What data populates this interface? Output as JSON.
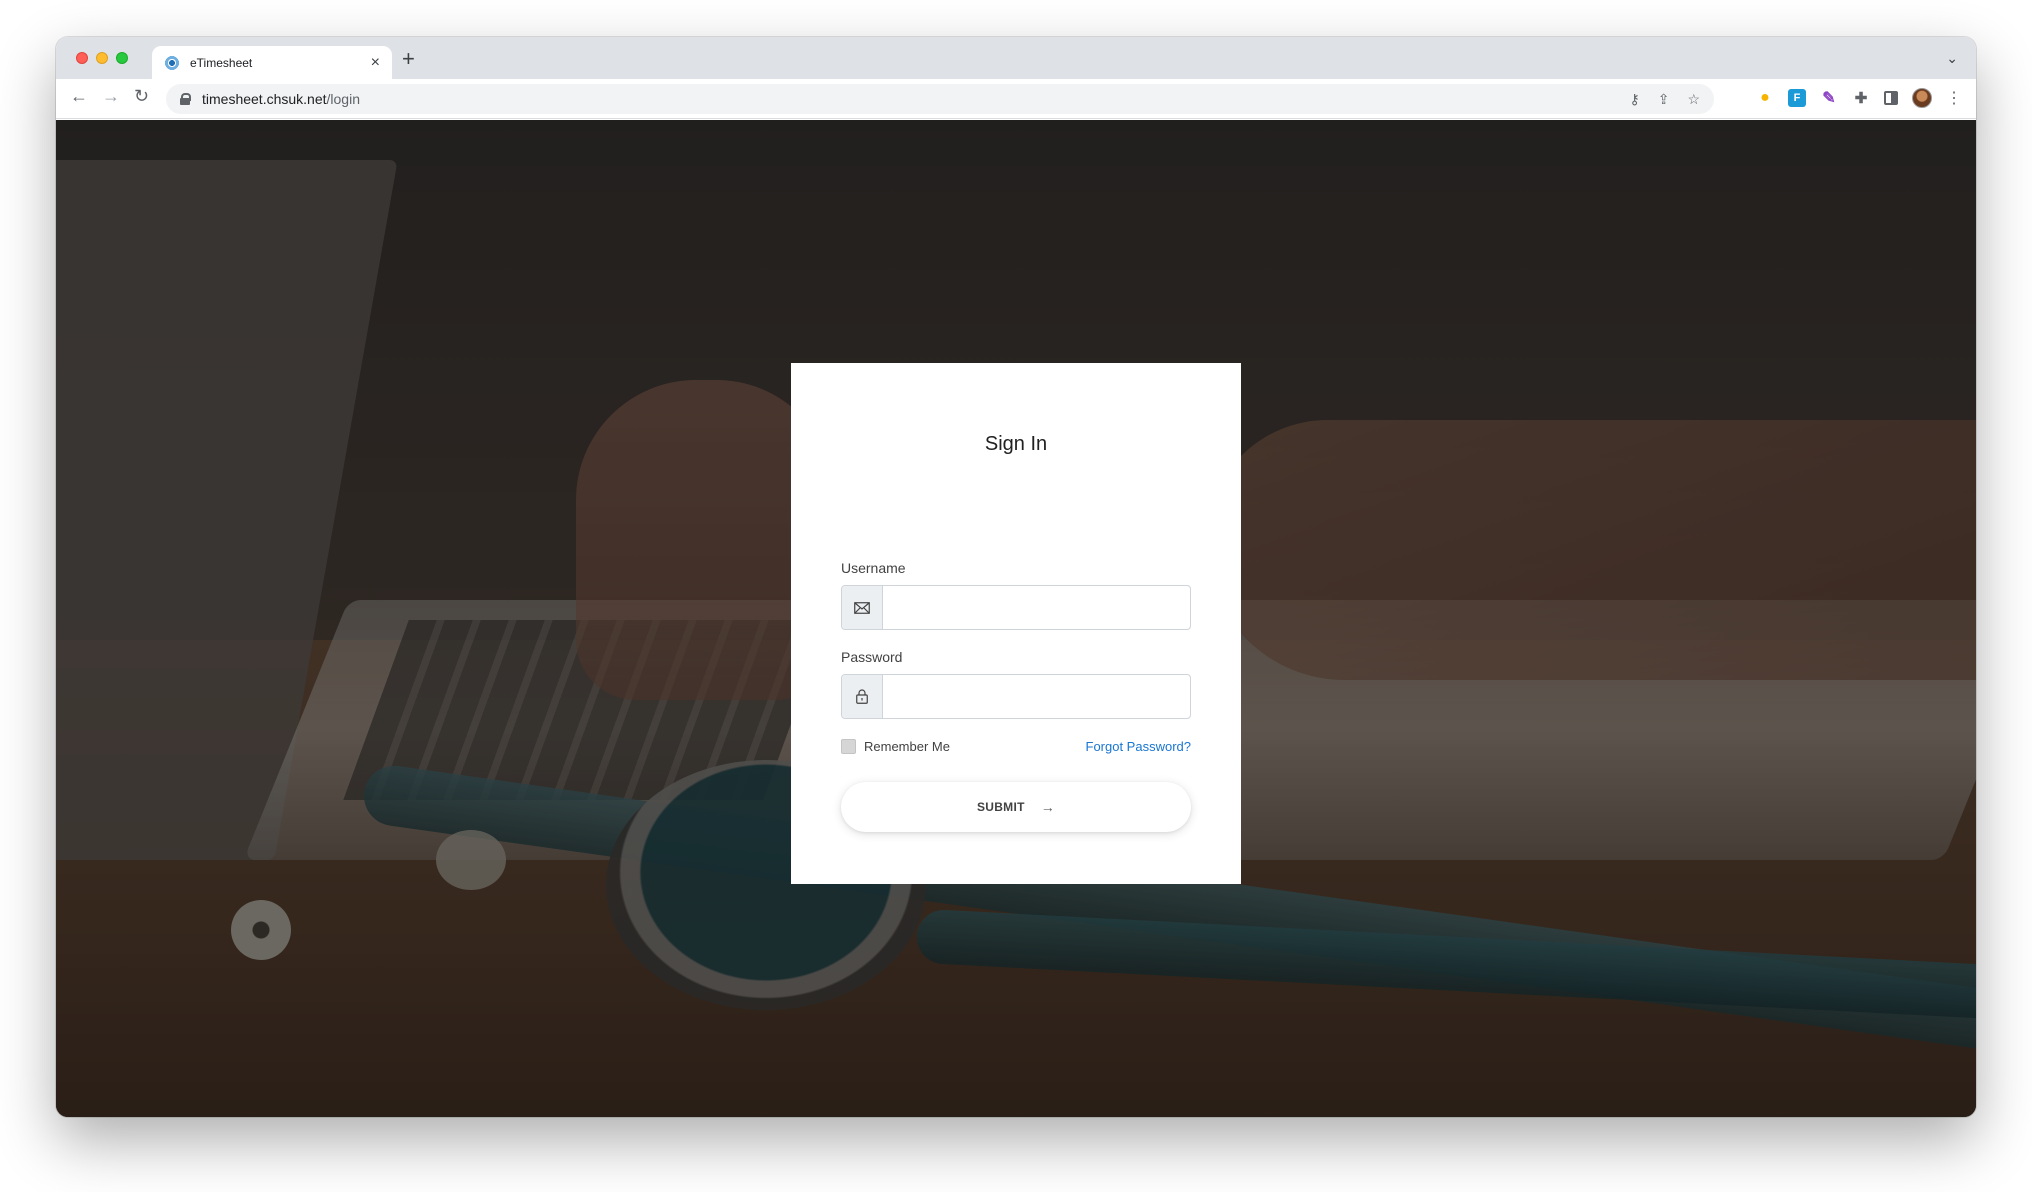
{
  "browser": {
    "tab_title": "eTimesheet",
    "tab_close": "×",
    "new_tab": "+",
    "tab_menu": "⌄",
    "url_host": "timesheet.chsuk.net",
    "url_path": "/login",
    "icons": {
      "back": "←",
      "forward": "→",
      "reload": "↻",
      "key": "⚷",
      "share": "⇪",
      "bookmark": "☆",
      "bulb": "●",
      "fb": "F",
      "pen": "✎",
      "puzzle": "✚",
      "menu": "⋮"
    }
  },
  "login": {
    "title": "Sign In",
    "username_label": "Username",
    "username_value": "",
    "password_label": "Password",
    "password_value": "",
    "remember_label": "Remember Me",
    "forgot_label": "Forgot Password?",
    "submit_label": "SUBMIT",
    "submit_arrow": "→"
  },
  "colors": {
    "link": "#1976d2",
    "card_bg": "#ffffff",
    "addon_bg": "#eceff1"
  }
}
